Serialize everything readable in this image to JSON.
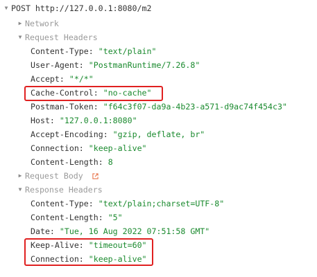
{
  "request": {
    "method": "POST",
    "url": "http://127.0.0.1:8080/m2"
  },
  "sections": {
    "network": "Network",
    "request_headers": "Request Headers",
    "request_body": "Request Body",
    "response_headers": "Response Headers"
  },
  "request_headers": [
    {
      "key": "Content-Type:",
      "value": "\"text/plain\""
    },
    {
      "key": "User-Agent:",
      "value": "\"PostmanRuntime/7.26.8\""
    },
    {
      "key": "Accept:",
      "value": "\"*/*\""
    },
    {
      "key": "Cache-Control:",
      "value": "\"no-cache\"",
      "highlighted": true
    },
    {
      "key": "Postman-Token:",
      "value": "\"f64c3f07-da9a-4b23-a571-d9ac74f454c3\""
    },
    {
      "key": "Host:",
      "value": "\"127.0.0.1:8080\""
    },
    {
      "key": "Accept-Encoding:",
      "value": "\"gzip, deflate, br\""
    },
    {
      "key": "Connection:",
      "value": "\"keep-alive\""
    },
    {
      "key": "Content-Length:",
      "value": "8"
    }
  ],
  "response_headers": [
    {
      "key": "Content-Type:",
      "value": "\"text/plain;charset=UTF-8\""
    },
    {
      "key": "Content-Length:",
      "value": "\"5\""
    },
    {
      "key": "Date:",
      "value": "\"Tue, 16 Aug 2022 07:51:58 GMT\""
    },
    {
      "key": "Keep-Alive:",
      "value": "\"timeout=60\"",
      "highlighted": true
    },
    {
      "key": "Connection:",
      "value": "\"keep-alive\"",
      "highlighted": true
    }
  ],
  "icons": {
    "expanded": "triangle-down-icon",
    "collapsed": "triangle-right-icon",
    "open_external": "external-link-icon"
  },
  "colors": {
    "value_text": "#1a8a2e",
    "section_header": "#9a9a9a",
    "highlight_border": "#e02020",
    "external_link": "#e8734a"
  }
}
